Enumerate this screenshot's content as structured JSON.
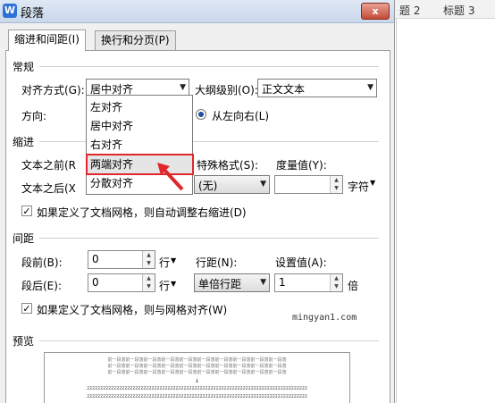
{
  "background": {
    "style_1": "题 2",
    "style_2": "标题 3"
  },
  "dialog": {
    "title": "段落",
    "app_icon": "W",
    "close": "x"
  },
  "tabs": {
    "indent_spacing": "缩进和间距(I)",
    "line_page_breaks": "换行和分页(P)"
  },
  "general": {
    "section": "常规",
    "alignment_label": "对齐方式(G):",
    "alignment_value": "居中对齐",
    "outline_label": "大纲级别(O):",
    "outline_value": "正文文本",
    "direction_label": "方向:",
    "direction_value": "从左向右(L)"
  },
  "alignment_options": [
    "左对齐",
    "居中对齐",
    "右对齐",
    "两端对齐",
    "分散对齐"
  ],
  "indent": {
    "section": "缩进",
    "before_label": "文本之前(R",
    "after_label": "文本之后(X",
    "special_label": "特殊格式(S):",
    "special_value": "(无)",
    "measure_label": "度量值(Y):",
    "measure_unit": "字符",
    "auto_adjust": "如果定义了文档网格，则自动调整右缩进(D)"
  },
  "spacing": {
    "section": "间距",
    "before_label": "段前(B):",
    "before_value": "0",
    "after_label": "段后(E):",
    "after_value": "0",
    "unit": "行",
    "line_label": "行距(N):",
    "line_value": "单倍行距",
    "set_label": "设置值(A):",
    "set_value": "1",
    "set_unit": "倍",
    "snap_grid": "如果定义了文档网格，则与网格对齐(W)"
  },
  "watermark": "mingyan1.com",
  "preview": {
    "section": "预览",
    "prev_line": "前一段落前一段落前一段落前一段落前一段落前一段落前一段落前一段落前一段落前一段落",
    "sample_line": "2222222222222222222222222222222222222222222222222222222222222222222222222222222222"
  },
  "colors": {
    "highlight": "#e0272c",
    "accent": "#1f4e9e"
  }
}
